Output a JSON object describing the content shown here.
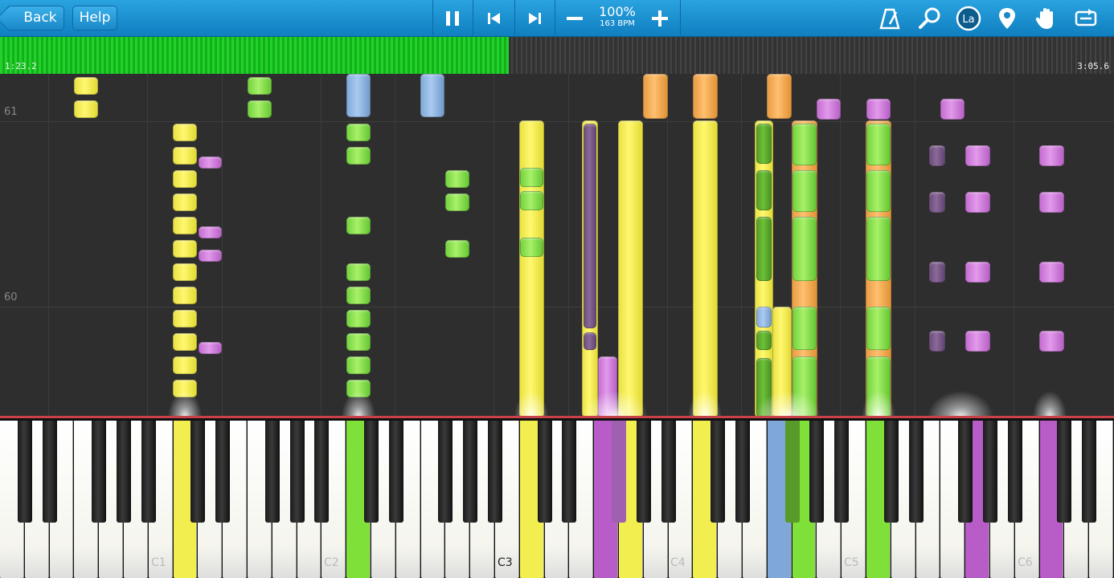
{
  "toolbar": {
    "back_label": "Back",
    "help_label": "Help",
    "tempo_percent": "100%",
    "tempo_bpm": "163 BPM",
    "icons": [
      "pause-icon",
      "skip-back-icon",
      "skip-forward-icon",
      "minus-icon",
      "plus-icon",
      "metronome-icon",
      "zoom-icon",
      "note-label-icon",
      "location-pin-icon",
      "hand-icon",
      "loop-icon"
    ]
  },
  "progress": {
    "elapsed": "1:23.2",
    "total": "3:05.6",
    "fraction": 0.457,
    "played_color": "#22d22a"
  },
  "measures": {
    "upper": "61",
    "lower": "60"
  },
  "keyboard": {
    "labels": [
      "C1",
      "C2",
      "C3",
      "C4",
      "C5",
      "C6"
    ]
  },
  "colors": {
    "toolbar": "#1a90d0",
    "yellow": "#fff870",
    "green": "#a8f06a",
    "purple": "#e19aea",
    "orange": "#ffc070",
    "blue": "#aacaf0"
  }
}
